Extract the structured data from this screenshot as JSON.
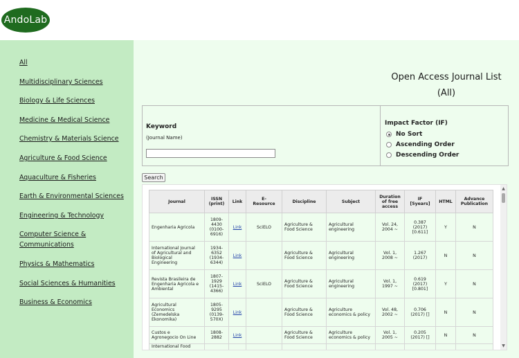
{
  "logo": {
    "text": "AndoLab"
  },
  "sidebar": {
    "items": [
      {
        "label": "All"
      },
      {
        "label": "Multidisciplinary Sciences"
      },
      {
        "label": "Biology & Life Sciences"
      },
      {
        "label": "Medicine & Medical Science"
      },
      {
        "label": "Chemistry & Materials Science"
      },
      {
        "label": "Agriculture & Food Science"
      },
      {
        "label": "Aquaculture & Fisheries"
      },
      {
        "label": "Earth & Environmental Sciences"
      },
      {
        "label": "Engineering & Technology"
      },
      {
        "label": "Computer Science & Communications"
      },
      {
        "label": "Physics & Mathematics"
      },
      {
        "label": "Social Sciences & Humanities"
      },
      {
        "label": "Business & Economics"
      }
    ]
  },
  "page": {
    "title": "Open Access Journal List",
    "subtitle": "(All)"
  },
  "search": {
    "keyword_label": "Keyword",
    "keyword_sub": "(Journal Name)",
    "keyword_value": "",
    "if_label": "Impact Factor (IF)",
    "options": [
      "No Sort",
      "Ascending Order",
      "Descending Order"
    ],
    "selected_option": "No Sort",
    "button_label": "Search"
  },
  "table": {
    "headers": [
      "Journal",
      "ISSN\n(print)",
      "Link",
      "E-\nResource",
      "Discipline",
      "Subject",
      "Duration\nof free\naccess",
      "IF\n[5years]",
      "HTML",
      "Advance\nPublication"
    ],
    "rows": [
      {
        "journal": "Engenharia Agricola",
        "issn": "1809-\n4430\n(0100-\n6916)",
        "link": "Link",
        "eresource": "SciELO",
        "discipline": "Agriculture &\nFood Science",
        "subject": "Agricultural\nengineering",
        "duration": "Vol. 24,\n2004 ~",
        "if": "0.387\n(2017)\n[0.611]",
        "html": "Y",
        "advance": "N"
      },
      {
        "journal": "International Journal\nof Agricultural and\nBiological\nEngineering",
        "issn": "1934-\n6352\n(1934-\n6344)",
        "link": "Link",
        "eresource": "",
        "discipline": "Agriculture &\nFood Science",
        "subject": "Agricultural\nengineering",
        "duration": "Vol. 1,\n2008 ~",
        "if": "1.267\n(2017)",
        "html": "N",
        "advance": "N"
      },
      {
        "journal": "Revista Brasileira de\nEngenharia Agricola e\nAmbiental",
        "issn": "1807-\n1929\n(1415-\n4366)",
        "link": "Link",
        "eresource": "SciELO",
        "discipline": "Agriculture &\nFood Science",
        "subject": "Agricultural\nengineering",
        "duration": "Vol. 1,\n1997 ~",
        "if": "0.619\n(2017)\n[0.801]",
        "html": "Y",
        "advance": "N"
      },
      {
        "journal": "Agricultural\nEconomics\n(Zemedelska\nEkonomika)",
        "issn": "1805-\n9295\n(0139-\n570X)",
        "link": "Link",
        "eresource": "",
        "discipline": "Agriculture &\nFood Science",
        "subject": "Agriculture\neconomics & policy",
        "duration": "Vol. 48,\n2002 ~",
        "if": "0.706\n(2017) []",
        "html": "N",
        "advance": "N"
      },
      {
        "journal": "Custos e\nAgronegocio On Line",
        "issn": "1808-\n2882",
        "link": "Link",
        "eresource": "",
        "discipline": "Agriculture &\nFood Science",
        "subject": "Agriculture\neconomics & policy",
        "duration": "Vol. 1,\n2005 ~",
        "if": "0.205\n(2017) []",
        "html": "N",
        "advance": "N"
      },
      {
        "journal": "International Food",
        "issn": "",
        "link": "",
        "eresource": "",
        "discipline": "",
        "subject": "",
        "duration": "",
        "if": "",
        "html": "",
        "advance": ""
      }
    ]
  },
  "icons": {
    "scroll_up": "triangle-up-icon",
    "scroll_down": "triangle-down-icon"
  }
}
